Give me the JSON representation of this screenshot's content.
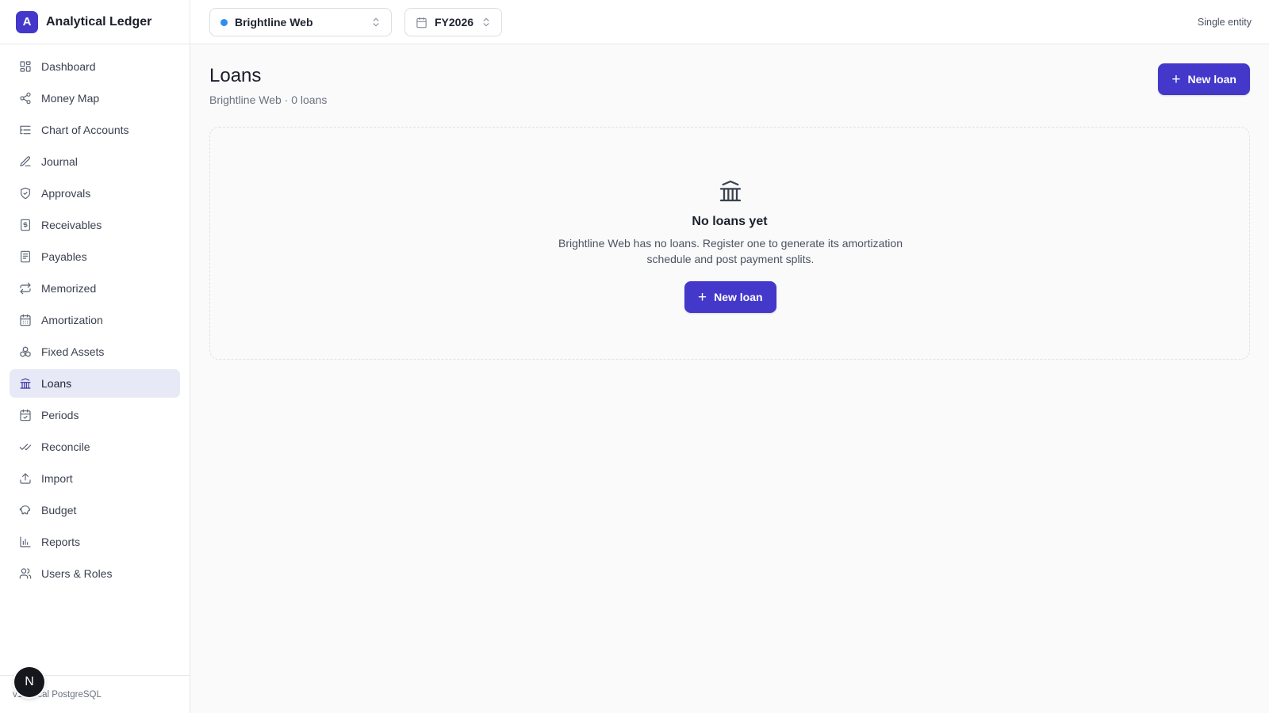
{
  "app": {
    "logo_letter": "A",
    "name": "Analytical Ledger",
    "brand_color": "#4338ca"
  },
  "sidebar": {
    "items": [
      {
        "label": "Dashboard",
        "icon": "dashboard-icon",
        "active": false
      },
      {
        "label": "Money Map",
        "icon": "share-icon",
        "active": false
      },
      {
        "label": "Chart of Accounts",
        "icon": "list-tree-icon",
        "active": false
      },
      {
        "label": "Journal",
        "icon": "pen-icon",
        "active": false
      },
      {
        "label": "Approvals",
        "icon": "shield-check-icon",
        "active": false
      },
      {
        "label": "Receivables",
        "icon": "receipt-dollar-icon",
        "active": false
      },
      {
        "label": "Payables",
        "icon": "document-icon",
        "active": false
      },
      {
        "label": "Memorized",
        "icon": "repeat-icon",
        "active": false
      },
      {
        "label": "Amortization",
        "icon": "calendar-grid-icon",
        "active": false
      },
      {
        "label": "Fixed Assets",
        "icon": "boxes-icon",
        "active": false
      },
      {
        "label": "Loans",
        "icon": "bank-icon",
        "active": true
      },
      {
        "label": "Periods",
        "icon": "calendar-check-icon",
        "active": false
      },
      {
        "label": "Reconcile",
        "icon": "check-check-icon",
        "active": false
      },
      {
        "label": "Import",
        "icon": "upload-icon",
        "active": false
      },
      {
        "label": "Budget",
        "icon": "piggy-bank-icon",
        "active": false
      },
      {
        "label": "Reports",
        "icon": "bar-chart-icon",
        "active": false
      },
      {
        "label": "Users & Roles",
        "icon": "users-icon",
        "active": false
      }
    ],
    "footer_text": "v1 · local PostgreSQL",
    "avatar_letter": "N"
  },
  "topbar": {
    "entity": "Brightline Web",
    "entity_dot_color": "#2f8cf0",
    "period": "FY2026",
    "mode": "Single entity"
  },
  "page": {
    "title": "Loans",
    "subtitle": "Brightline Web · 0 loans",
    "new_button": "New loan"
  },
  "empty_state": {
    "icon": "bank-icon",
    "title": "No loans yet",
    "text": "Brightline Web has no loans. Register one to generate its amortization schedule and post payment splits.",
    "button": "New loan"
  }
}
